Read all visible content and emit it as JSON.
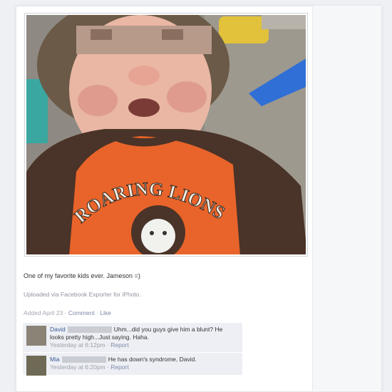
{
  "post": {
    "caption": "One of my favorite kids ever. Jameson =)",
    "uploaded": "Uploaded via Facebook Exporter for iPhoto.",
    "added": "Added April 23",
    "comment_link": "Comment",
    "like_link": "Like",
    "separator": " · "
  },
  "shirt_text": "ROARING LIONS",
  "comments": [
    {
      "author": "David",
      "text": "Uhm...did you guys give him a blunt? He looks pretty high...Just saying. Haha.",
      "time": "Yesterday at 6:12pm",
      "report": "Report"
    },
    {
      "author": "Mia",
      "text": "He has down's syndrome, David.",
      "time": "Yesterday at 6:20pm",
      "report": "Report"
    }
  ],
  "colors": {
    "link": "#3b5998",
    "comment_bg": "#edeff4",
    "shirt_orange": "#e8642a",
    "shirt_brown": "#4a3328"
  }
}
